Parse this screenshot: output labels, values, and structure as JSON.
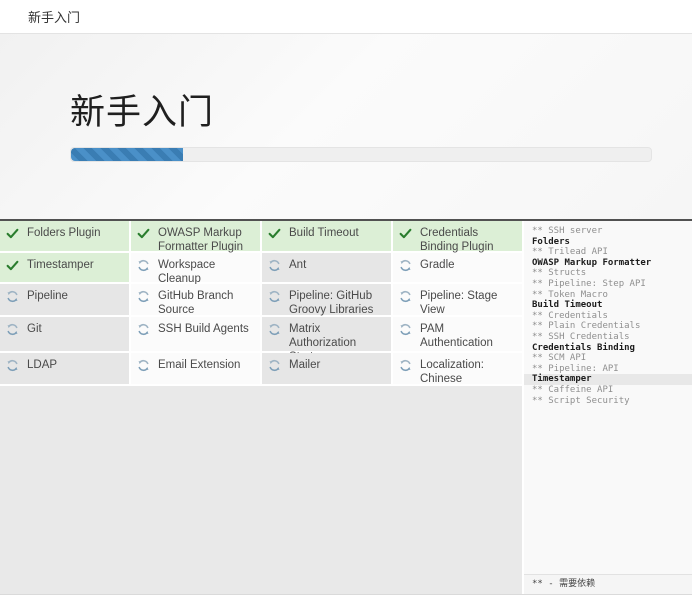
{
  "topbar": {
    "title": "新手入门"
  },
  "hero": {
    "heading": "新手入门",
    "progress_percent": 19.3
  },
  "colors": {
    "bar_blue": "#4a90c8",
    "bar_blue_dark": "#3a7db3",
    "done_bg": "#dcefd6",
    "done_check": "#2a7d2e",
    "pending_gray_bg": "#e6e6e6",
    "pending_white_bg": "#fbfbfb",
    "spinner_blue": "#7e9fb8",
    "spinner_gray": "#9fb4c4"
  },
  "plugins": {
    "cells": [
      {
        "label": "Folders Plugin",
        "status": "done",
        "bg": "green"
      },
      {
        "label": "OWASP Markup Formatter Plugin",
        "status": "done",
        "bg": "green"
      },
      {
        "label": "Build Timeout",
        "status": "done",
        "bg": "green"
      },
      {
        "label": "Credentials Binding Plugin",
        "status": "done",
        "bg": "green"
      },
      {
        "label": "Timestamper",
        "status": "done",
        "bg": "green"
      },
      {
        "label": "Workspace Cleanup",
        "status": "installing",
        "bg": "white"
      },
      {
        "label": "Ant",
        "status": "installing",
        "bg": "gray"
      },
      {
        "label": "Gradle",
        "status": "installing",
        "bg": "white"
      },
      {
        "label": "Pipeline",
        "status": "installing",
        "bg": "gray"
      },
      {
        "label": "GitHub Branch Source",
        "status": "installing",
        "bg": "white"
      },
      {
        "label": "Pipeline: GitHub Groovy Libraries",
        "status": "installing",
        "bg": "gray"
      },
      {
        "label": "Pipeline: Stage View",
        "status": "installing",
        "bg": "white"
      },
      {
        "label": "Git",
        "status": "installing",
        "bg": "gray"
      },
      {
        "label": "SSH Build Agents",
        "status": "installing",
        "bg": "white"
      },
      {
        "label": "Matrix Authorization Strategy",
        "status": "installing",
        "bg": "gray"
      },
      {
        "label": "PAM Authentication",
        "status": "installing",
        "bg": "white"
      },
      {
        "label": "LDAP",
        "status": "installing",
        "bg": "gray"
      },
      {
        "label": "Email Extension",
        "status": "installing",
        "bg": "white"
      },
      {
        "label": "Mailer",
        "status": "installing",
        "bg": "gray"
      },
      {
        "label": "Localization: Chinese (Simplified)",
        "status": "installing",
        "bg": "white"
      }
    ]
  },
  "log": {
    "lines": [
      {
        "text": "** SSH server",
        "style": "dep"
      },
      {
        "text": "Folders",
        "style": "plugin"
      },
      {
        "text": "** Trilead API",
        "style": "dep"
      },
      {
        "text": "OWASP Markup Formatter",
        "style": "plugin"
      },
      {
        "text": "** Structs",
        "style": "dep"
      },
      {
        "text": "** Pipeline: Step API",
        "style": "dep"
      },
      {
        "text": "** Token Macro",
        "style": "dep"
      },
      {
        "text": "Build Timeout",
        "style": "plugin"
      },
      {
        "text": "** Credentials",
        "style": "dep"
      },
      {
        "text": "** Plain Credentials",
        "style": "dep"
      },
      {
        "text": "** SSH Credentials",
        "style": "dep"
      },
      {
        "text": "Credentials Binding",
        "style": "plugin"
      },
      {
        "text": "** SCM API",
        "style": "dep"
      },
      {
        "text": "** Pipeline: API",
        "style": "dep"
      },
      {
        "text": "Timestamper",
        "style": "plugin",
        "highlight": true
      },
      {
        "text": "** Caffeine API",
        "style": "dep"
      },
      {
        "text": "** Script Security",
        "style": "dep"
      }
    ],
    "footer": "** - 需要依赖"
  }
}
